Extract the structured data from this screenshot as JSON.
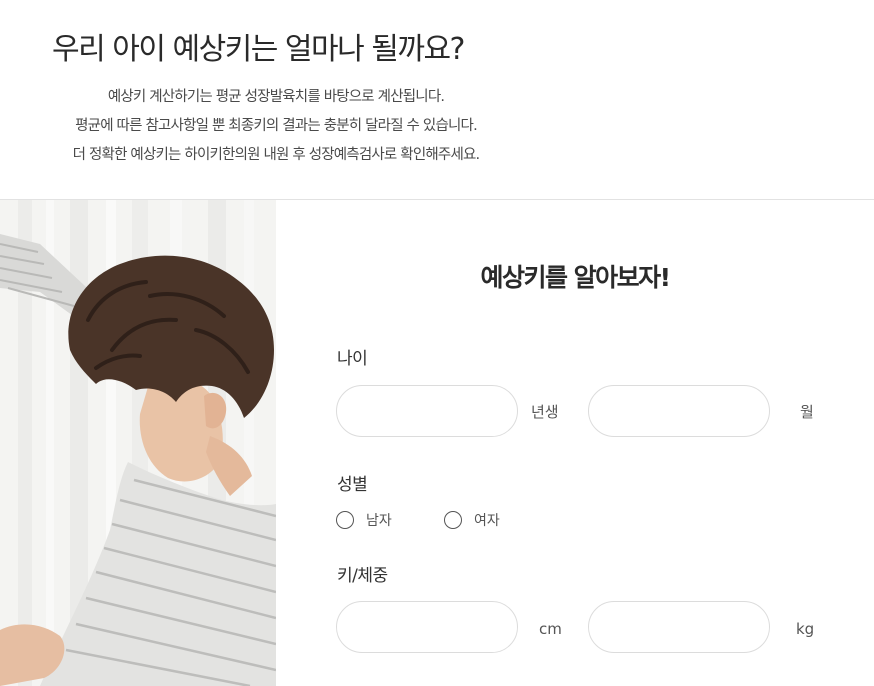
{
  "header": {
    "title": "우리 아이 예상키는 얼마나 될까요?",
    "description": [
      "예상키 계산하기는 평균 성장발육치를 바탕으로 계산됩니다.",
      "평균에 따른 참고사항일 뿐 최종키의 결과는 충분히 달라질 수 있습니다.",
      "더 정확한 예상키는 하이키한의원 내원 후 성장예측검사로 확인해주세요."
    ]
  },
  "form": {
    "title": "예상키를 알아보자!",
    "age": {
      "label": "나이",
      "year_value": "",
      "year_unit": "년생",
      "month_value": "",
      "month_unit": "월"
    },
    "gender": {
      "label": "성별",
      "options": [
        "남자",
        "여자"
      ],
      "selected": ""
    },
    "body": {
      "label": "키/체중",
      "height_value": "",
      "height_unit": "cm",
      "weight_value": "",
      "weight_unit": "kg"
    }
  }
}
